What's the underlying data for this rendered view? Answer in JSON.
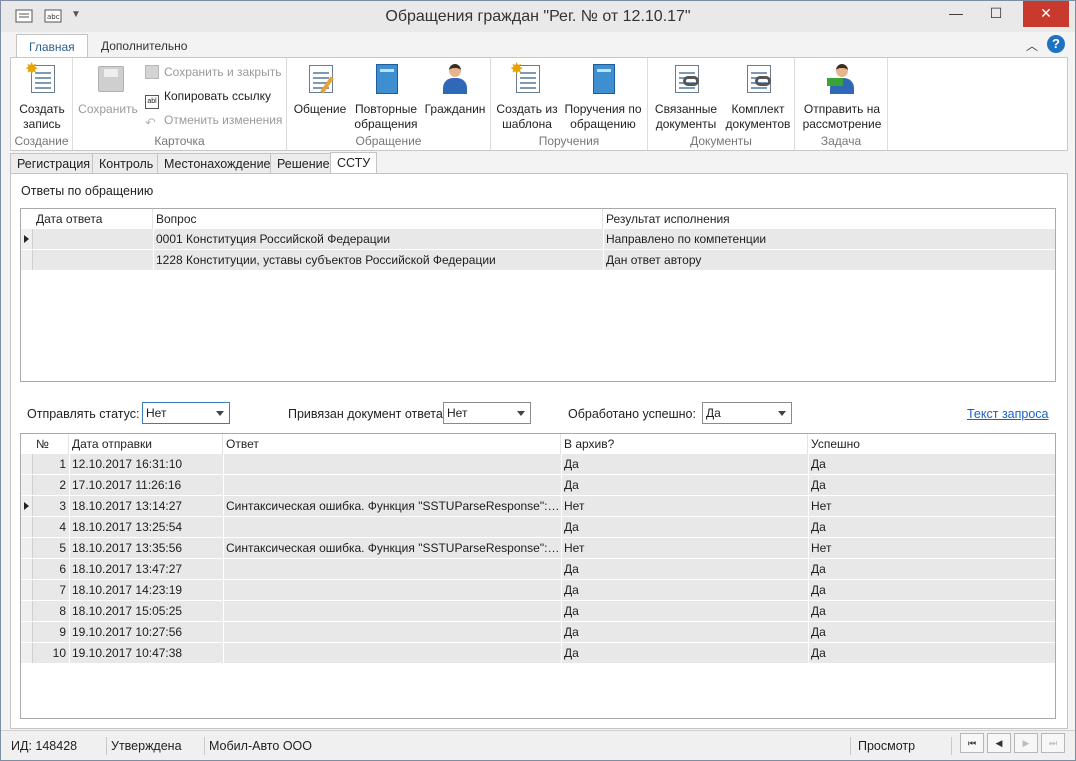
{
  "window": {
    "title": "Обращения граждан \"Рег. № от 12.10.17\"",
    "controls": {
      "minimize": "—",
      "maximize": "☐",
      "close": "✕"
    }
  },
  "ribbon_tabs": [
    "Главная",
    "Дополнительно"
  ],
  "ribbon": {
    "groups": [
      {
        "label": "Создание",
        "buttons": [
          {
            "label": "Создать запись",
            "icon": "new-record-icon"
          }
        ]
      },
      {
        "label": "Карточка",
        "buttons": [
          {
            "label": "Сохранить",
            "icon": "save-icon",
            "disabled": true
          }
        ],
        "small": [
          {
            "label": "Сохранить и закрыть",
            "icon": "save-close-icon",
            "disabled": true
          },
          {
            "label": "Копировать ссылку",
            "icon": "copy-link-icon",
            "disabled": false
          },
          {
            "label": "Отменить изменения",
            "icon": "undo-icon",
            "disabled": true
          }
        ]
      },
      {
        "label": "Обращение",
        "buttons": [
          {
            "label": "Общение",
            "icon": "edit-document-icon"
          },
          {
            "label": "Повторные обращения",
            "icon": "book-icon"
          },
          {
            "label": "Гражданин",
            "icon": "person-icon"
          }
        ]
      },
      {
        "label": "Поручения",
        "buttons": [
          {
            "label": "Создать из шаблона",
            "icon": "template-icon"
          },
          {
            "label": "Поручения по обращению",
            "icon": "book-icon"
          }
        ]
      },
      {
        "label": "Документы",
        "buttons": [
          {
            "label": "Связанные документы",
            "icon": "linked-docs-icon"
          },
          {
            "label": "Комплект документов",
            "icon": "doc-set-icon"
          }
        ]
      },
      {
        "label": "Задача",
        "buttons": [
          {
            "label": "Отправить на рассмотрение",
            "icon": "send-review-icon"
          }
        ]
      }
    ]
  },
  "page_tabs": [
    "Регистрация",
    "Контроль",
    "Местонахождение",
    "Решение",
    "ССТУ"
  ],
  "answers": {
    "title": "Ответы по обращению",
    "columns": [
      "Дата ответа",
      "Вопрос",
      "Результат исполнения"
    ],
    "rows": [
      {
        "date": "",
        "question": "0001 Конституция Российской Федерации",
        "result": "Направлено по компетенции"
      },
      {
        "date": "",
        "question": "1228 Конституции, уставы субъектов Российской Федерации",
        "result": "Дан ответ автору"
      }
    ]
  },
  "filters": {
    "send_status": {
      "label": "Отправлять статус:",
      "value": "Нет"
    },
    "linked_doc": {
      "label": "Привязан документ ответа:",
      "value": "Нет"
    },
    "processed": {
      "label": "Обработано успешно:",
      "value": "Да"
    },
    "request_link": "Текст запроса"
  },
  "sends": {
    "columns": [
      "№",
      "Дата отправки",
      "Ответ",
      "В архив?",
      "Успешно"
    ],
    "rows": [
      {
        "n": "1",
        "date": "12.10.2017 16:31:10",
        "answer": "",
        "archive": "Да",
        "ok": "Да"
      },
      {
        "n": "2",
        "date": "17.10.2017 11:26:16",
        "answer": "",
        "archive": "Да",
        "ok": "Да"
      },
      {
        "n": "3",
        "date": "18.10.2017 13:14:27",
        "answer": "Синтаксическая ошибка. Функция \"SSTUParseResponse\": о...",
        "archive": "Нет",
        "ok": "Нет"
      },
      {
        "n": "4",
        "date": "18.10.2017 13:25:54",
        "answer": "",
        "archive": "Да",
        "ok": "Да"
      },
      {
        "n": "5",
        "date": "18.10.2017 13:35:56",
        "answer": "Синтаксическая ошибка. Функция \"SSTUParseResponse\": о...",
        "archive": "Нет",
        "ok": "Нет"
      },
      {
        "n": "6",
        "date": "18.10.2017 13:47:27",
        "answer": "",
        "archive": "Да",
        "ok": "Да"
      },
      {
        "n": "7",
        "date": "18.10.2017 14:23:19",
        "answer": "",
        "archive": "Да",
        "ok": "Да"
      },
      {
        "n": "8",
        "date": "18.10.2017 15:05:25",
        "answer": "",
        "archive": "Да",
        "ok": "Да"
      },
      {
        "n": "9",
        "date": "19.10.2017 10:27:56",
        "answer": "",
        "archive": "Да",
        "ok": "Да"
      },
      {
        "n": "10",
        "date": "19.10.2017 10:47:38",
        "answer": "",
        "archive": "Да",
        "ok": "Да"
      }
    ]
  },
  "status_bar": {
    "id": "ИД: 148428",
    "state": "Утверждена",
    "org": "Мобил-Авто ООО",
    "mode": "Просмотр",
    "nav": [
      "⏮",
      "◀",
      "▶",
      "⏭"
    ]
  }
}
